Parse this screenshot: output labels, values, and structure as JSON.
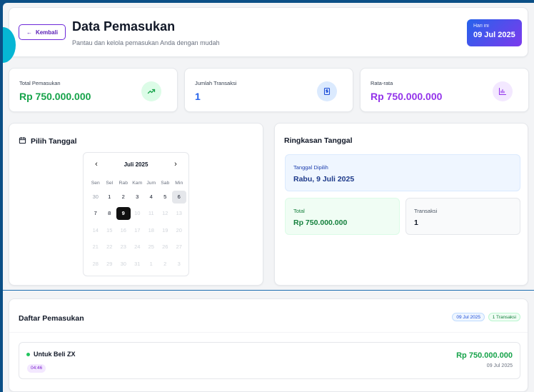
{
  "header": {
    "back_label": "Kembali",
    "title": "Data Pemasukan",
    "subtitle": "Pantau dan kelola pemasukan Anda dengan mudah",
    "today_label": "Hari ini",
    "today_value": "09 Jul 2025",
    "gradient_colors": [
      "#2563eb",
      "#7c3aed"
    ]
  },
  "stats": [
    {
      "label": "Total Pemasukan",
      "value": "Rp 750.000.000",
      "icon": "trending-up-icon",
      "color": "#16a34a",
      "icon_bg": "#dcfce7"
    },
    {
      "label": "Jumlah Transaksi",
      "value": "1",
      "icon": "receipt-icon",
      "color": "#2563eb",
      "icon_bg": "#dbeafe"
    },
    {
      "label": "Rata-rata",
      "value": "Rp 750.000.000",
      "icon": "bar-chart-icon",
      "color": "#9333ea",
      "icon_bg": "#f3e8ff"
    }
  ],
  "picker": {
    "title": "Pilih Tanggal",
    "icon": "calendar-icon",
    "calendar": {
      "month_label": "Juli 2025",
      "prev": "‹",
      "next": "›",
      "weekdays": [
        "Sen",
        "Sel",
        "Rab",
        "Kam",
        "Jum",
        "Sab",
        "Min"
      ],
      "weeks": [
        [
          "30",
          "1",
          "2",
          "3",
          "4",
          "5",
          "6"
        ],
        [
          "7",
          "8",
          "9",
          "10",
          "11",
          "12",
          "13"
        ],
        [
          "14",
          "15",
          "16",
          "17",
          "18",
          "19",
          "20"
        ],
        [
          "21",
          "22",
          "23",
          "24",
          "25",
          "26",
          "27"
        ],
        [
          "28",
          "29",
          "30",
          "31",
          "1",
          "2",
          "3"
        ]
      ],
      "selected_day": "9"
    }
  },
  "summary": {
    "title": "Ringkasan Tanggal",
    "selected_label": "Tanggal Dipilih",
    "selected_value": "Rabu, 9 Juli 2025",
    "total_label": "Total",
    "total_value": "Rp 750.000.000",
    "trans_label": "Transaksi",
    "trans_value": "1"
  },
  "list": {
    "title": "Daftar Pemasukan",
    "badge_date": "09 Jul 2025",
    "badge_count": "1 Transaksi",
    "entries": [
      {
        "name": "Untuk Beli ZX",
        "time": "04:46",
        "amount": "Rp 750.000.000",
        "date": "09 Jul 2025"
      }
    ]
  }
}
